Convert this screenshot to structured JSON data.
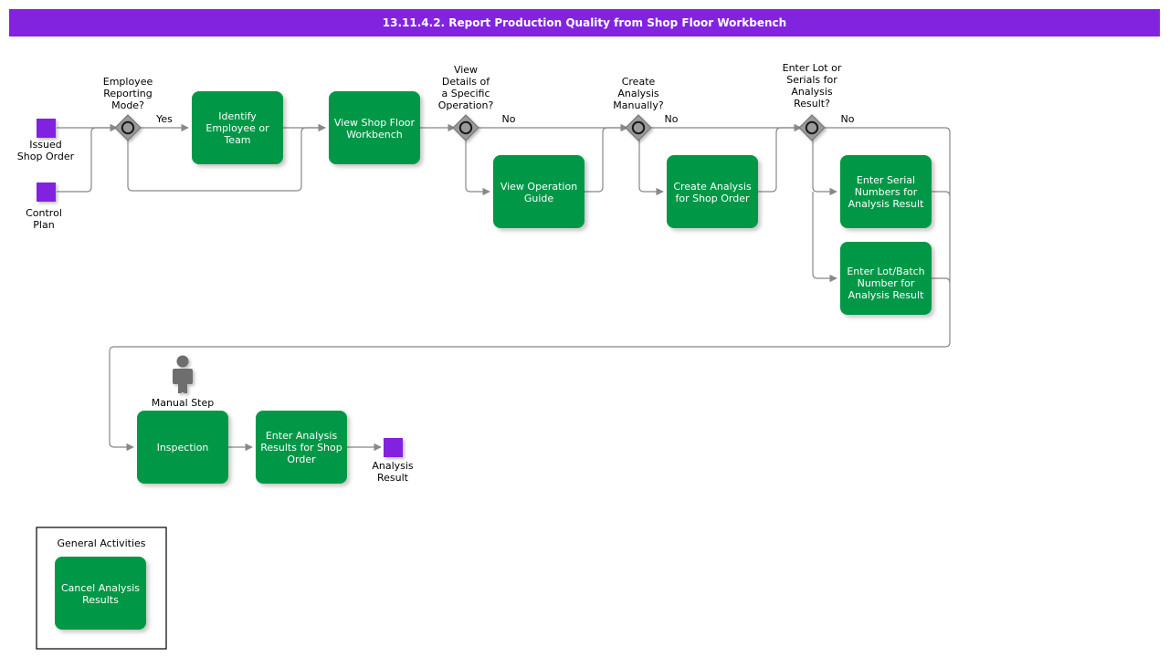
{
  "header": {
    "title": "13.11.4.2. Report Production Quality from Shop Floor Workbench",
    "background_color": "#8223e0",
    "text_color": "#ffffff"
  },
  "colors": {
    "task_green": "#009846",
    "data_purple": "#8223e0",
    "gateway_gray": "#9a9a9a",
    "flow_line": "#888888",
    "actor_gray": "#6e6e6e"
  },
  "data_objects": [
    {
      "id": "issued-shop-order",
      "label_line1": "Issued",
      "label_line2": "Shop Order"
    },
    {
      "id": "control-plan",
      "label_line1": "Control",
      "label_line2": "Plan"
    },
    {
      "id": "analysis-result",
      "label_line1": "Analysis",
      "label_line2": "Result"
    }
  ],
  "gateways": [
    {
      "id": "employee-reporting-mode",
      "label_lines": [
        "Employee",
        "Reporting",
        "Mode?"
      ],
      "branch_label": "Yes"
    },
    {
      "id": "view-details-of-a-specific-operation",
      "label_lines": [
        "View",
        "Details of",
        "a Specific",
        "Operation?"
      ],
      "branch_label": "No"
    },
    {
      "id": "create-analysis-manually",
      "label_lines": [
        "Create",
        "Analysis",
        "Manually?"
      ],
      "branch_label": "No"
    },
    {
      "id": "enter-lot-or-serials-for-analysis-result",
      "label_lines": [
        "Enter Lot or",
        "Serials for",
        "Analysis",
        "Result?"
      ],
      "branch_label": "No"
    }
  ],
  "tasks": [
    {
      "id": "identify-employee-or-team",
      "lines": [
        "Identify",
        "Employee or",
        "Team"
      ]
    },
    {
      "id": "view-shop-floor-workbench",
      "lines": [
        "View Shop Floor",
        "Workbench"
      ]
    },
    {
      "id": "view-operation-guide",
      "lines": [
        "View Operation",
        "Guide"
      ]
    },
    {
      "id": "create-analysis-for-shop-order",
      "lines": [
        "Create Analysis",
        "for Shop Order"
      ]
    },
    {
      "id": "enter-serial-numbers-for-analysis-result",
      "lines": [
        "Enter Serial",
        "Numbers for",
        "Analysis Result"
      ]
    },
    {
      "id": "enter-lot-batch-number-for-analysis-result",
      "lines": [
        "Enter Lot/Batch",
        "Number for",
        "Analysis Result"
      ]
    },
    {
      "id": "inspection",
      "lines": [
        "Inspection"
      ]
    },
    {
      "id": "enter-analysis-results-for-shop-order",
      "lines": [
        "Enter Analysis",
        "Results for Shop",
        "Order"
      ]
    },
    {
      "id": "cancel-analysis-results",
      "lines": [
        "Cancel Analysis",
        "Results"
      ]
    }
  ],
  "annotations": {
    "manual_step_label": "Manual Step",
    "manual_step_icon": "person-icon"
  },
  "groups": [
    {
      "id": "general-activities",
      "title": "General Activities"
    }
  ]
}
